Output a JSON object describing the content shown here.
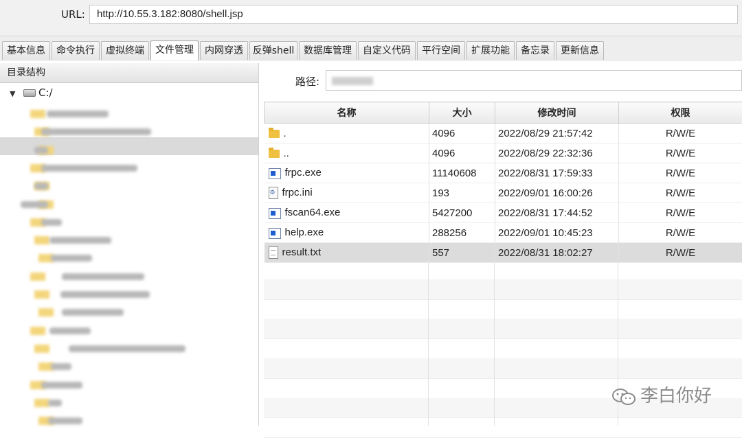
{
  "url": {
    "label": "URL:",
    "value": "http://10.55.3.182:8080/shell.jsp"
  },
  "tabs": [
    "基本信息",
    "命令执行",
    "虚拟终端",
    "文件管理",
    "内网穿透",
    "反弹shell",
    "数据库管理",
    "自定义代码",
    "平行空间",
    "扩展功能",
    "备忘录",
    "更新信息"
  ],
  "active_tab": "文件管理",
  "left_panel": {
    "title": "目录结构",
    "root": "C:/"
  },
  "path": {
    "label": "路径:"
  },
  "columns": {
    "name": "名称",
    "size": "大小",
    "mtime": "修改时间",
    "perm": "权限"
  },
  "files": [
    {
      "name": ".",
      "icon": "folder-icon",
      "size": "4096",
      "mtime": "2022/08/29 21:57:42",
      "perm": "R/W/E"
    },
    {
      "name": "..",
      "icon": "folder-icon",
      "size": "4096",
      "mtime": "2022/08/29 22:32:36",
      "perm": "R/W/E"
    },
    {
      "name": "frpc.exe",
      "icon": "exe-icon",
      "size": "11140608",
      "mtime": "2022/08/31 17:59:33",
      "perm": "R/W/E"
    },
    {
      "name": "frpc.ini",
      "icon": "ini-file-icon",
      "size": "193",
      "mtime": "2022/09/01 16:00:26",
      "perm": "R/W/E"
    },
    {
      "name": "fscan64.exe",
      "icon": "exe-icon",
      "size": "5427200",
      "mtime": "2022/08/31 17:44:52",
      "perm": "R/W/E"
    },
    {
      "name": "help.exe",
      "icon": "exe-icon",
      "size": "288256",
      "mtime": "2022/09/01 10:45:23",
      "perm": "R/W/E"
    },
    {
      "name": "result.txt",
      "icon": "text-file-icon",
      "size": "557",
      "mtime": "2022/08/31 18:02:27",
      "perm": "R/W/E",
      "selected": true
    }
  ],
  "watermark": "李白你好"
}
